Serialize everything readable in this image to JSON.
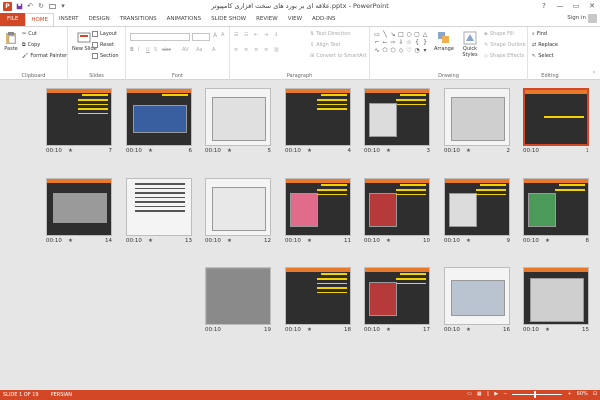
{
  "window": {
    "title": "علاقه ای بر بورد های سخت افزاری کامپیوتر.pptx - PowerPoint",
    "app_logo": "P",
    "signin": "Sign in",
    "controls": [
      "?",
      "—",
      "▭",
      "✕"
    ]
  },
  "tabs": [
    {
      "label": "FILE"
    },
    {
      "label": "HOME"
    },
    {
      "label": "INSERT"
    },
    {
      "label": "DESIGN"
    },
    {
      "label": "TRANSITIONS"
    },
    {
      "label": "ANIMATIONS"
    },
    {
      "label": "SLIDE SHOW"
    },
    {
      "label": "REVIEW"
    },
    {
      "label": "VIEW"
    },
    {
      "label": "ADD-INS"
    }
  ],
  "ribbon": {
    "clipboard": {
      "label": "Clipboard",
      "paste": "Paste",
      "cut": "Cut",
      "copy": "Copy",
      "format_painter": "Format Painter"
    },
    "slides": {
      "label": "Slides",
      "new_slide": "New Slide",
      "layout": "Layout",
      "reset": "Reset",
      "section": "Section"
    },
    "font": {
      "label": "Font"
    },
    "paragraph": {
      "label": "Paragraph",
      "text_direction": "Text Direction",
      "align_text": "Align Text",
      "smartart": "Convert to SmartArt"
    },
    "drawing": {
      "label": "Drawing",
      "arrange": "Arrange",
      "quick_styles": "Quick Styles",
      "shape_fill": "Shape Fill",
      "shape_outline": "Shape Outline",
      "shape_effects": "Shape Effects"
    },
    "editing": {
      "label": "Editing",
      "find": "Find",
      "replace": "Replace",
      "select": "Select"
    }
  },
  "slides": [
    {
      "num": "1",
      "dur": "00:10"
    },
    {
      "num": "2",
      "dur": "00:10",
      "star": "★"
    },
    {
      "num": "3",
      "dur": "00:10",
      "star": "★"
    },
    {
      "num": "4",
      "dur": "00:10",
      "star": "★"
    },
    {
      "num": "5",
      "dur": "00:10",
      "star": "★"
    },
    {
      "num": "6",
      "dur": "00:10",
      "star": "★"
    },
    {
      "num": "7",
      "dur": "00:10",
      "star": "★"
    },
    {
      "num": "8",
      "dur": "00:10",
      "star": "★"
    },
    {
      "num": "9",
      "dur": "00:10",
      "star": "★"
    },
    {
      "num": "10",
      "dur": "00:10",
      "star": "★"
    },
    {
      "num": "11",
      "dur": "00:10",
      "star": "★"
    },
    {
      "num": "12",
      "dur": "00:10",
      "star": "★"
    },
    {
      "num": "13",
      "dur": "00:10",
      "star": "★"
    },
    {
      "num": "14",
      "dur": "00:10",
      "star": "★"
    },
    {
      "num": "15",
      "dur": "00:10",
      "star": "★"
    },
    {
      "num": "16",
      "dur": "00:10",
      "star": "★"
    },
    {
      "num": "17",
      "dur": "00:10",
      "star": "★"
    },
    {
      "num": "18",
      "dur": "00:10",
      "star": "★"
    },
    {
      "num": "19",
      "dur": "00:10"
    }
  ],
  "status": {
    "slide_count": "SLIDE 1 OF 19",
    "language": "PERSIAN",
    "zoom": "60%"
  },
  "colors": {
    "accent": "#d24726",
    "slide_title": "#f2d200",
    "slide_bar": "#e8792a"
  }
}
